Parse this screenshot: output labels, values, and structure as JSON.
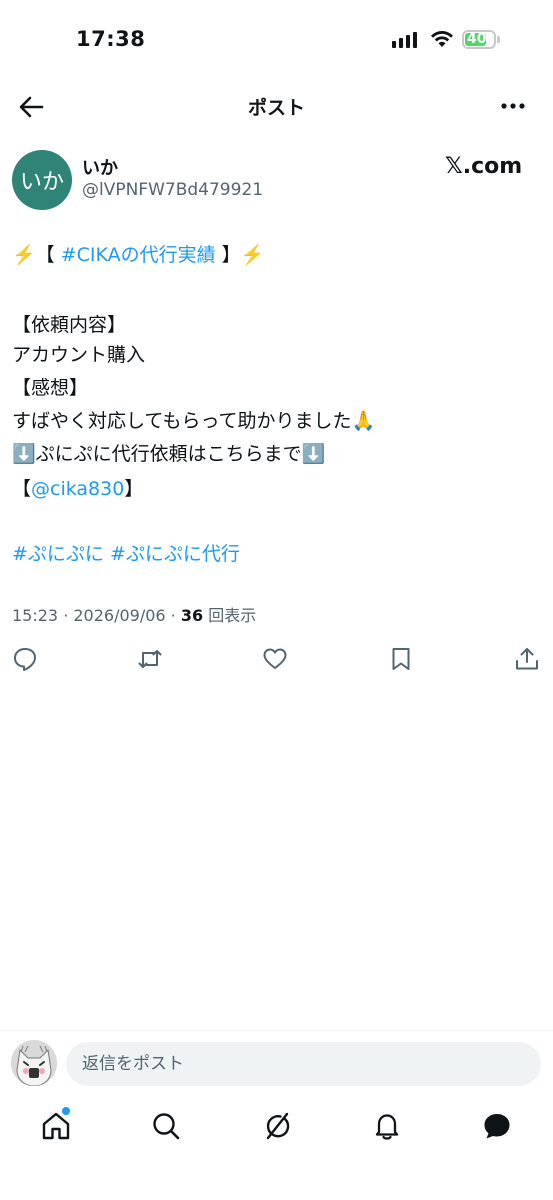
{
  "status_bar": {
    "time": "17:38",
    "battery": "40"
  },
  "header": {
    "title": "ポスト"
  },
  "author": {
    "avatar_text": "いか",
    "name": "いか",
    "handle": "@lVPNFW7Bd479921",
    "badge": "𝕏.com"
  },
  "post": {
    "line1_prefix": "⚡️【 ",
    "line1_tag": "#CIKAの代行実績",
    "line1_suffix": " 】⚡️",
    "line2": "【依頼内容】",
    "line3": "アカウント購入",
    "line4": "【感想】",
    "line5": "すばやく対応してもらって助かりました🙏",
    "line6": "⬇️ぷにぷに代行依頼はこちらまで⬇️",
    "line7_prefix": "【",
    "line7_mention": "@cika830",
    "line7_suffix": "】",
    "tag1": "#ぷにぷに",
    "tag2": "#ぷにぷに代行",
    "timestamp": "15:23 · 2026/09/06 · ",
    "views_count": "36",
    "views_label": " 回表示"
  },
  "actions": [
    "reply-icon",
    "repost-icon",
    "like-icon",
    "bookmark-icon",
    "share-icon"
  ],
  "reply": {
    "placeholder": "返信をポスト"
  },
  "tabs": [
    "home-icon",
    "search-icon",
    "grok-icon",
    "notifications-icon",
    "messages-icon"
  ],
  "colors": {
    "accent": "#1d9bf0",
    "avatar_bg": "#2f8377",
    "text": "#0f1419",
    "muted": "#536471"
  }
}
